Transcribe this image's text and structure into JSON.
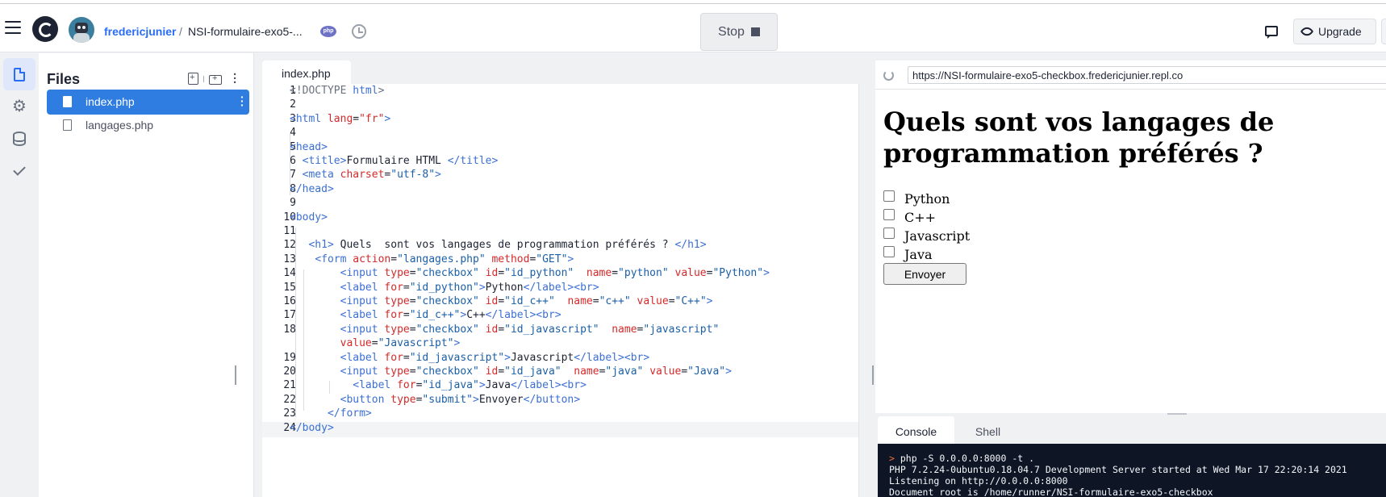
{
  "header": {
    "user": "fredericjunier",
    "separator": "/",
    "repl_name": "NSI-formulaire-exo5-...",
    "stop_label": "Stop",
    "upgrade_label": "Upgrade",
    "icons": [
      "menu-icon",
      "replit-logo",
      "avatar",
      "php-icon",
      "history-icon",
      "chat-icon",
      "rocket-icon"
    ]
  },
  "sidebar": {
    "items": [
      {
        "name": "files",
        "icon": "file-icon",
        "active": true
      },
      {
        "name": "settings",
        "icon": "gear-icon",
        "active": false
      },
      {
        "name": "database",
        "icon": "database-icon",
        "active": false
      },
      {
        "name": "unit-tests",
        "icon": "check-icon",
        "active": false
      }
    ]
  },
  "files": {
    "title": "Files",
    "items": [
      {
        "name": "index.php",
        "selected": true
      },
      {
        "name": "langages.php",
        "selected": false
      }
    ]
  },
  "editor": {
    "tab_label": "index.php",
    "current_line": 24,
    "lines": [
      {
        "n": "1",
        "html": "<span class=\"tk-doc\">&lt;!DOCTYPE</span> <span class=\"tk-tag\">html</span><span class=\"tk-doc\">&gt;</span>"
      },
      {
        "n": "2",
        "html": ""
      },
      {
        "n": "3",
        "html": "<span class=\"tk-tag\">&lt;html</span> <span class=\"tk-attr\">lang</span>=<span class=\"tk-attr\">\"fr\"</span><span class=\"tk-tag\">&gt;</span>"
      },
      {
        "n": "4",
        "html": ""
      },
      {
        "n": "5",
        "html": "<span class=\"tk-tag\">&lt;head&gt;</span>"
      },
      {
        "n": "6",
        "html": "  <span class=\"tk-tag\">&lt;title&gt;</span>Formulaire HTML <span class=\"tk-tag\">&lt;/title&gt;</span>"
      },
      {
        "n": "7",
        "html": "  <span class=\"tk-tag\">&lt;meta</span> <span class=\"tk-attr\">charset</span>=<span class=\"tk-str\">\"utf-8\"</span><span class=\"tk-tag\">&gt;</span>"
      },
      {
        "n": "8",
        "html": "<span class=\"tk-tag\">&lt;/head&gt;</span>"
      },
      {
        "n": "9",
        "html": ""
      },
      {
        "n": "10",
        "html": "<span class=\"tk-tag\">&lt;body&gt;</span>"
      },
      {
        "n": "11",
        "html": ""
      },
      {
        "n": "12",
        "html": "   <span class=\"tk-tag\">&lt;h1&gt;</span> Quels  sont vos langages de programmation préférés ? <span class=\"tk-tag\">&lt;/h1&gt;</span>"
      },
      {
        "n": "13",
        "html": "    <span class=\"tk-tag\">&lt;form</span> <span class=\"tk-attr\">action</span>=<span class=\"tk-str\">\"langages.php\"</span> <span class=\"tk-attr\">method</span>=<span class=\"tk-str\">\"GET\"</span><span class=\"tk-tag\">&gt;</span>"
      },
      {
        "n": "14",
        "html": "        <span class=\"tk-tag\">&lt;input</span> <span class=\"tk-attr\">type</span>=<span class=\"tk-str\">\"checkbox\"</span> <span class=\"tk-attr\">id</span>=<span class=\"tk-str\">\"id_python\"</span>  <span class=\"tk-attr\">name</span>=<span class=\"tk-str\">\"python\"</span> <span class=\"tk-attr\">value</span>=<span class=\"tk-str\">\"Python\"</span><span class=\"tk-tag\">&gt;</span>"
      },
      {
        "n": "15",
        "html": "        <span class=\"tk-tag\">&lt;label</span> <span class=\"tk-attr\">for</span>=<span class=\"tk-str\">\"id_python\"</span><span class=\"tk-tag\">&gt;</span>Python<span class=\"tk-tag\">&lt;/label&gt;&lt;br&gt;</span>"
      },
      {
        "n": "16",
        "html": "        <span class=\"tk-tag\">&lt;input</span> <span class=\"tk-attr\">type</span>=<span class=\"tk-str\">\"checkbox\"</span> <span class=\"tk-attr\">id</span>=<span class=\"tk-str\">\"id_c++\"</span>  <span class=\"tk-attr\">name</span>=<span class=\"tk-str\">\"c++\"</span> <span class=\"tk-attr\">value</span>=<span class=\"tk-str\">\"C++\"</span><span class=\"tk-tag\">&gt;</span>"
      },
      {
        "n": "17",
        "html": "        <span class=\"tk-tag\">&lt;label</span> <span class=\"tk-attr\">for</span>=<span class=\"tk-str\">\"id_c++\"</span><span class=\"tk-tag\">&gt;</span>C++<span class=\"tk-tag\">&lt;/label&gt;&lt;br&gt;</span>"
      },
      {
        "n": "18",
        "html": "        <span class=\"tk-tag\">&lt;input</span> <span class=\"tk-attr\">type</span>=<span class=\"tk-str\">\"checkbox\"</span> <span class=\"tk-attr\">id</span>=<span class=\"tk-str\">\"id_javascript\"</span>  <span class=\"tk-attr\">name</span>=<span class=\"tk-str\">\"javascript\"</span>"
      },
      {
        "n": "",
        "html": "        <span class=\"tk-attr\">value</span>=<span class=\"tk-str\">\"Javascript\"</span><span class=\"tk-tag\">&gt;</span>"
      },
      {
        "n": "19",
        "html": "        <span class=\"tk-tag\">&lt;label</span> <span class=\"tk-attr\">for</span>=<span class=\"tk-str\">\"id_javascript\"</span><span class=\"tk-tag\">&gt;</span>Javascript<span class=\"tk-tag\">&lt;/label&gt;&lt;br&gt;</span>"
      },
      {
        "n": "20",
        "html": "        <span class=\"tk-tag\">&lt;input</span> <span class=\"tk-attr\">type</span>=<span class=\"tk-str\">\"checkbox\"</span> <span class=\"tk-attr\">id</span>=<span class=\"tk-str\">\"id_java\"</span>  <span class=\"tk-attr\">name</span>=<span class=\"tk-str\">\"java\"</span> <span class=\"tk-attr\">value</span>=<span class=\"tk-str\">\"Java\"</span><span class=\"tk-tag\">&gt;</span>"
      },
      {
        "n": "21",
        "html": "          <span class=\"tk-tag\">&lt;label</span> <span class=\"tk-attr\">for</span>=<span class=\"tk-str\">\"id_java\"</span><span class=\"tk-tag\">&gt;</span>Java<span class=\"tk-tag\">&lt;/label&gt;&lt;br&gt;</span>"
      },
      {
        "n": "22",
        "html": "        <span class=\"tk-tag\">&lt;button</span> <span class=\"tk-attr\">type</span>=<span class=\"tk-str\">\"submit\"</span><span class=\"tk-tag\">&gt;</span>Envoyer<span class=\"tk-tag\">&lt;/button&gt;</span>"
      },
      {
        "n": "23",
        "html": "      <span class=\"tk-tag\">&lt;/form&gt;</span>"
      },
      {
        "n": "24",
        "html": "<span class=\"tk-tag\">&lt;/body&gt;</span>"
      }
    ]
  },
  "preview": {
    "url": "https://NSI-formulaire-exo5-checkbox.fredericjunier.repl.co",
    "heading": "Quels sont vos langages de programmation préférés ?",
    "options": [
      "Python",
      "C++",
      "Javascript",
      "Java"
    ],
    "submit_label": "Envoyer"
  },
  "console": {
    "tabs": [
      {
        "label": "Console",
        "active": true
      },
      {
        "label": "Shell",
        "active": false
      }
    ],
    "prompt": ">",
    "command": " php -S 0.0.0.0:8000 -t .",
    "output": [
      "PHP 7.2.24-0ubuntu0.18.04.7 Development Server started at Wed Mar 17 22:20:14 2021",
      "Listening on http://0.0.0.0:8000",
      "Document root is /home/runner/NSI-formulaire-exo5-checkbox"
    ]
  }
}
